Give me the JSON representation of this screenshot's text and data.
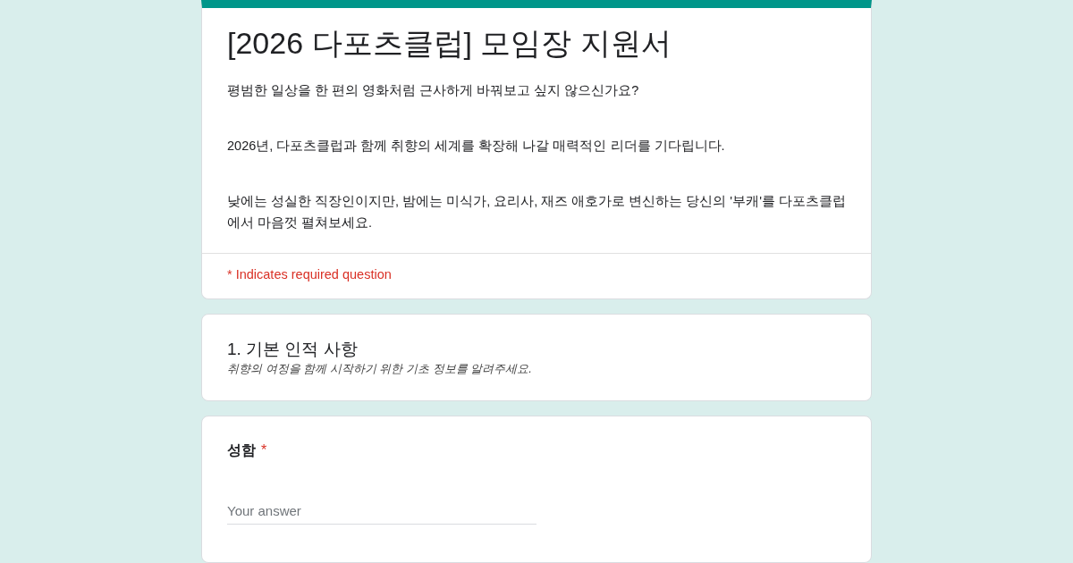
{
  "form": {
    "title": "[2026 다포츠클럽] 모임장 지원서",
    "description": [
      "평범한 일상을 한 편의 영화처럼 근사하게 바꿔보고 싶지 않으신가요?",
      "2026년, 다포츠클럽과 함께 취향의 세계를 확장해 나갈 매력적인 리더를 기다립니다.",
      "낮에는 성실한 직장인이지만, 밤에는 미식가, 요리사, 재즈 애호가로 변신하는 당신의 '부캐'를 다포츠클럽에서 마음껏 펼쳐보세요."
    ],
    "required_note": "* Indicates required question"
  },
  "section": {
    "title": "1. 기본 인적 사항",
    "subtitle": "취향의 여정을 함께 시작하기 위한 기초 정보를 알려주세요."
  },
  "question": {
    "label": "성함",
    "required_mark": "*",
    "placeholder": "Your answer"
  }
}
